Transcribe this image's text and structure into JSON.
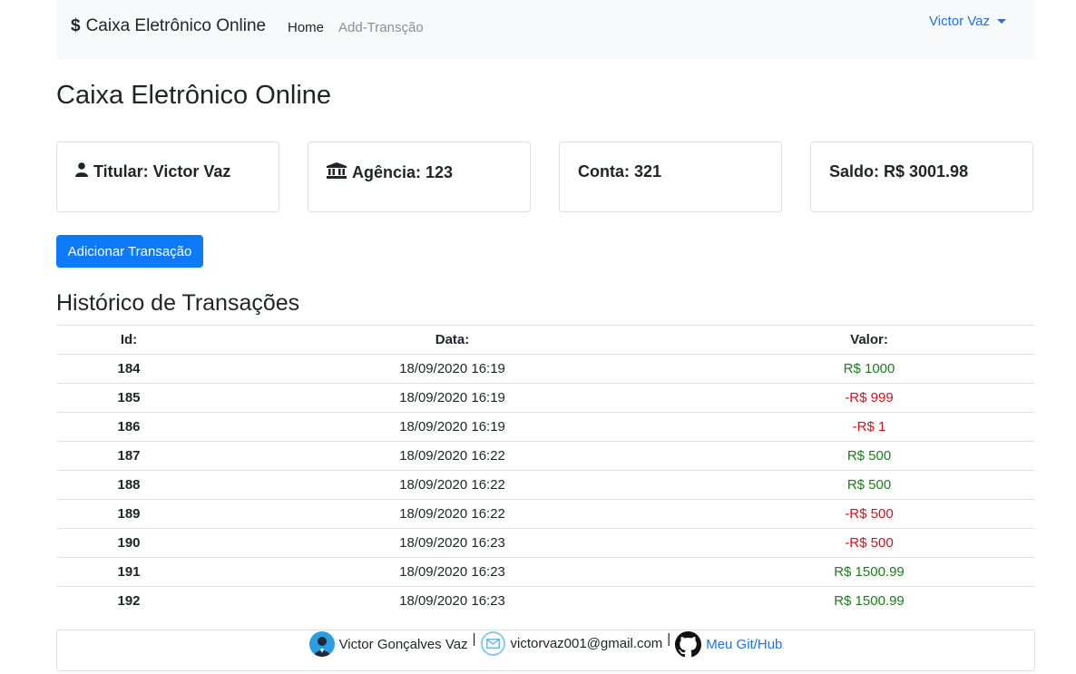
{
  "navbar": {
    "brand": "Caixa Eletrônico Online",
    "brand_icon": "dollar-icon",
    "home": "Home",
    "add": "Add-Transção",
    "user": "Victor Vaz"
  },
  "page_title": "Caixa Eletrônico Online",
  "cards": {
    "titular": "Titular: Victor Vaz",
    "agencia": "Agência: 123",
    "conta": "Conta: 321",
    "saldo": "Saldo: R$ 3001.98"
  },
  "add_button": "Adicionar Transação",
  "history_title": "Histórico de Transações",
  "table": {
    "headers": {
      "id": "Id:",
      "data": "Data:",
      "valor": "Valor:"
    },
    "rows": [
      {
        "id": "184",
        "data": "18/09/2020 16:19",
        "valor": "R$ 1000"
      },
      {
        "id": "185",
        "data": "18/09/2020 16:19",
        "valor": "-R$ 999"
      },
      {
        "id": "186",
        "data": "18/09/2020 16:19",
        "valor": "-R$ 1"
      },
      {
        "id": "187",
        "data": "18/09/2020 16:22",
        "valor": "R$ 500"
      },
      {
        "id": "188",
        "data": "18/09/2020 16:22",
        "valor": "R$ 500"
      },
      {
        "id": "189",
        "data": "18/09/2020 16:22",
        "valor": "-R$ 500"
      },
      {
        "id": "190",
        "data": "18/09/2020 16:23",
        "valor": "-R$ 500"
      },
      {
        "id": "191",
        "data": "18/09/2020 16:23",
        "valor": "R$ 1500.99"
      },
      {
        "id": "192",
        "data": "18/09/2020 16:23",
        "valor": "R$ 1500.99"
      }
    ]
  },
  "footer": {
    "name": "Victor Gonçalves Vaz",
    "email": "victorvaz001@gmail.com",
    "github": "Meu Git/Hub",
    "separator": "|"
  },
  "colors": {
    "accent": "#0d7bf7",
    "positive": "#1e7b1e",
    "negative": "#d0121b",
    "navbar_bg": "#f8f9fa"
  }
}
